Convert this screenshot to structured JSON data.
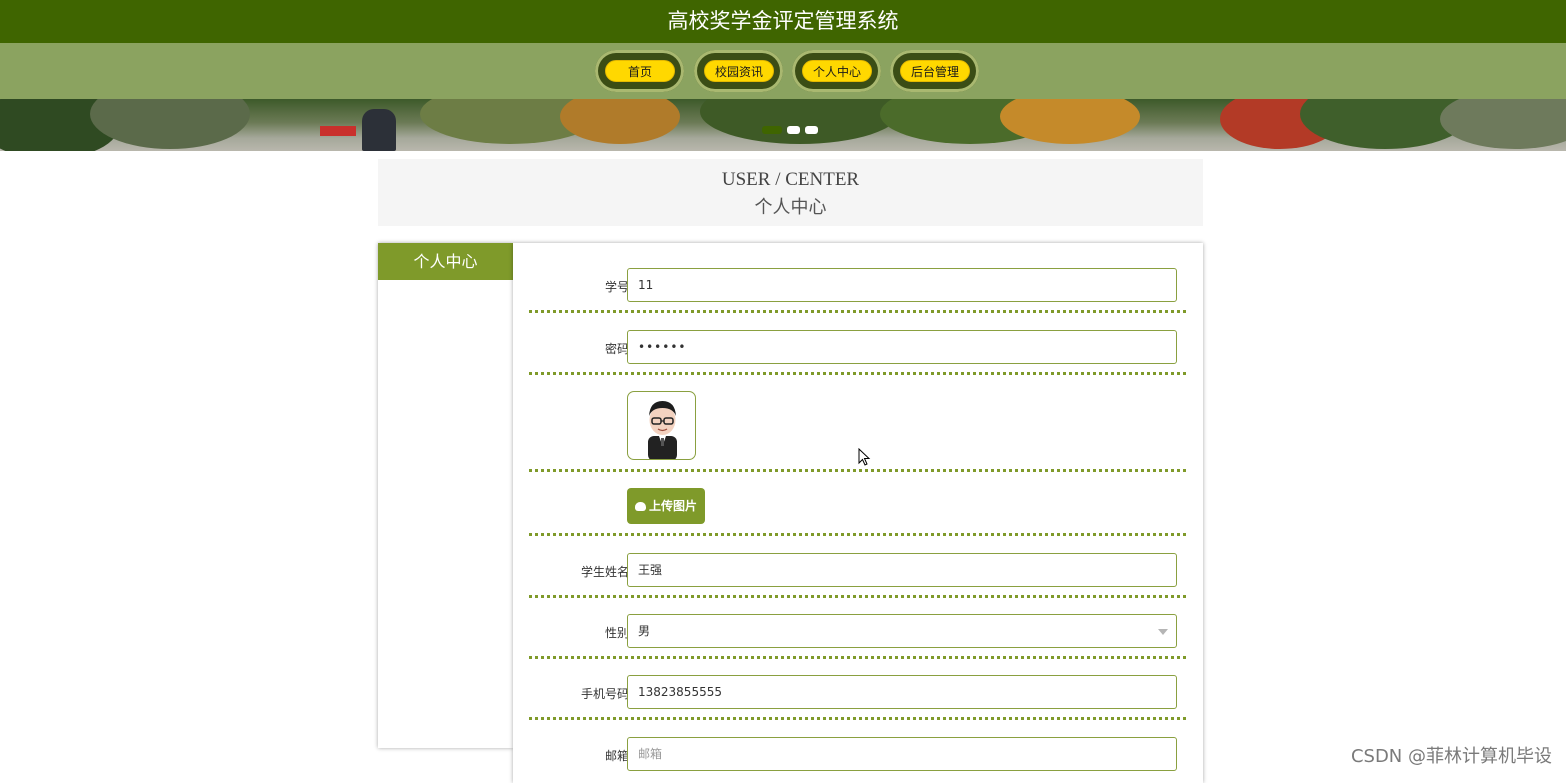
{
  "header": {
    "title": "高校奖学金评定管理系统"
  },
  "nav": {
    "items": [
      {
        "label": "首页"
      },
      {
        "label": "校园资讯"
      },
      {
        "label": "个人中心"
      },
      {
        "label": "后台管理"
      }
    ]
  },
  "banner": {
    "slides_total": 3,
    "active_slide": 1
  },
  "section": {
    "title_en": "USER / CENTER",
    "title_cn": "个人中心"
  },
  "sidebar": {
    "heading": "个人中心"
  },
  "form": {
    "student_id": {
      "label": "学号",
      "value": "11"
    },
    "password": {
      "label": "密码",
      "value": "••••••"
    },
    "upload": {
      "label": "上传图片"
    },
    "name": {
      "label": "学生姓名",
      "value": "王强"
    },
    "gender": {
      "label": "性别",
      "value": "男"
    },
    "phone": {
      "label": "手机号码",
      "value": "13823855555"
    },
    "email": {
      "label": "邮箱",
      "placeholder": "邮箱"
    }
  },
  "watermark": "CSDN @菲林计算机毕设",
  "colors": {
    "header_bg": "#3f6500",
    "nav_bg": "#8ba360",
    "pill_yellow": "#ffd800",
    "accent_green": "#7f9a2a"
  }
}
